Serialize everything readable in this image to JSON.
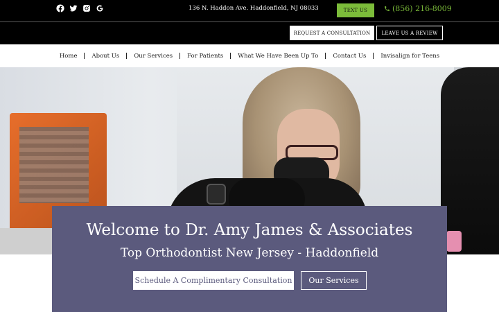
{
  "topbar": {
    "social_icons": [
      "facebook-icon",
      "twitter-icon",
      "instagram-icon",
      "google-icon"
    ],
    "address": "136 N. Haddon Ave. Haddonfield, NJ 08033",
    "text_us_label": "TEXT US",
    "phone": "(856) 216-8009",
    "request_consultation_label": "REQUEST A CONSULTATION",
    "leave_review_label": "LEAVE US A REVIEW"
  },
  "nav": {
    "items": [
      {
        "label": "Home"
      },
      {
        "label": "About Us"
      },
      {
        "label": "Our Services"
      },
      {
        "label": "For Patients"
      },
      {
        "label": "What We Have Been Up To"
      },
      {
        "label": "Contact Us"
      },
      {
        "label": "Invisalign for Teens"
      }
    ]
  },
  "hero": {
    "title": "Welcome to Dr. Amy James & Associates",
    "subtitle": "Top Orthodontist New Jersey - Haddonfield",
    "schedule_label": "Schedule A Complimentary Consultation",
    "services_label": "Our Services"
  },
  "colors": {
    "accent_green": "#7cbc3a",
    "panel_purple": "#5b5a7d",
    "topbar_black": "#000000"
  }
}
